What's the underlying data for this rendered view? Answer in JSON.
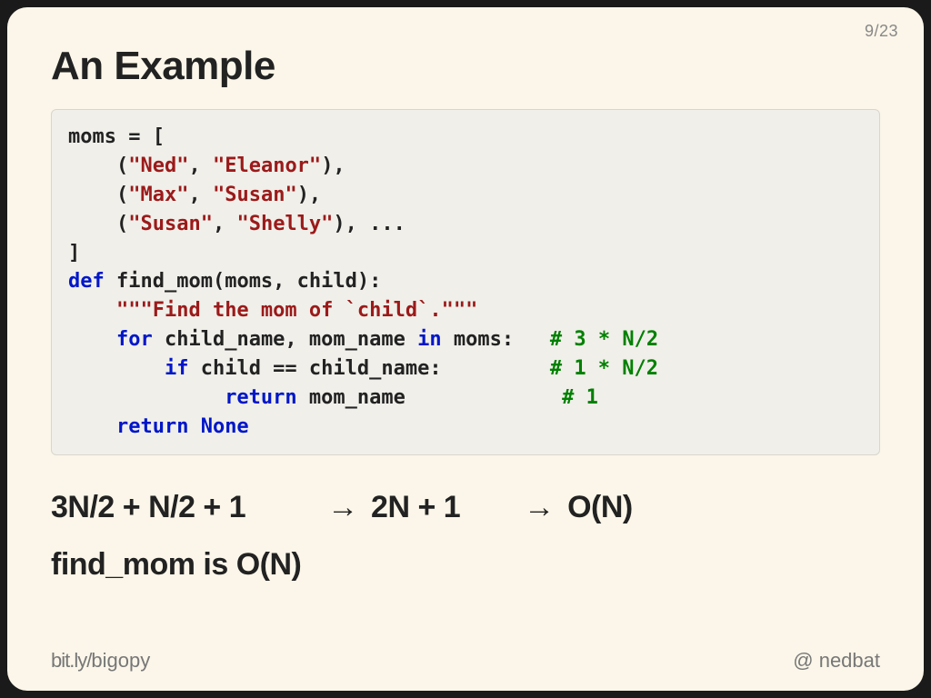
{
  "page": {
    "current": 9,
    "total": 23,
    "display": "9/23"
  },
  "title": "An Example",
  "code": {
    "l1a": "moms = [",
    "l2a": "    (",
    "l2b": "\"Ned\"",
    "l2c": ", ",
    "l2d": "\"Eleanor\"",
    "l2e": "),",
    "l3a": "    (",
    "l3b": "\"Max\"",
    "l3c": ", ",
    "l3d": "\"Susan\"",
    "l3e": "),",
    "l4a": "    (",
    "l4b": "\"Susan\"",
    "l4c": ", ",
    "l4d": "\"Shelly\"",
    "l4e": "), ...",
    "l5a": "]",
    "l6a": "def",
    "l6b": " find_mom(moms, child):",
    "l7a": "    ",
    "l7b": "\"\"\"Find the mom of `child`.\"\"\"",
    "l8a": "    ",
    "l8b": "for",
    "l8c": " child_name, mom_name ",
    "l8d": "in",
    "l8e": " moms:   ",
    "l8f": "# 3 * N/2",
    "l9a": "        ",
    "l9b": "if",
    "l9c": " child == child_name:         ",
    "l9f": "# 1 * N/2",
    "l10a": "             ",
    "l10b": "return",
    "l10c": " mom_name             ",
    "l10f": "# 1",
    "l11a": "    ",
    "l11b": "return None"
  },
  "math": {
    "part1": "3N/2 + N/2 + 1",
    "arrow": "→",
    "part2": "2N + 1",
    "part3": "O(N)"
  },
  "conclusion": "find_mom is O(N)",
  "footer": {
    "left_a": "bit.ly/",
    "left_b": "bigopy",
    "right_a": "@",
    "right_b": "nedbat"
  }
}
